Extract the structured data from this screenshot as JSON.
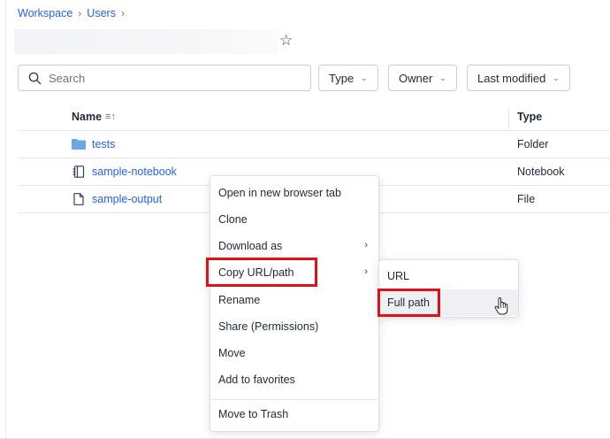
{
  "breadcrumb": {
    "items": [
      "Workspace",
      "Users"
    ],
    "separator": "›"
  },
  "header": {
    "star_glyph": "☆"
  },
  "toolbar": {
    "search_placeholder": "Search",
    "filters": [
      {
        "label": "Type",
        "chevron": "⌄"
      },
      {
        "label": "Owner",
        "chevron": "⌄"
      },
      {
        "label": "Last modified",
        "chevron": "⌄"
      }
    ]
  },
  "table": {
    "columns": {
      "name": "Name",
      "sort_glyph": "≡↑",
      "type": "Type"
    },
    "rows": [
      {
        "name": "tests",
        "type": "Folder",
        "icon": "folder-icon"
      },
      {
        "name": "sample-notebook",
        "type": "Notebook",
        "icon": "notebook-icon"
      },
      {
        "name": "sample-output",
        "type": "File",
        "icon": "file-icon"
      }
    ]
  },
  "context_menu": {
    "items": [
      {
        "label": "Open in new browser tab"
      },
      {
        "label": "Clone"
      },
      {
        "label": "Download as",
        "arrow": "›"
      },
      {
        "label": "Copy URL/path",
        "arrow": "›"
      },
      {
        "label": "Rename"
      },
      {
        "label": "Share (Permissions)"
      },
      {
        "label": "Move"
      },
      {
        "label": "Add to favorites"
      },
      {
        "label": "Move to Trash"
      }
    ]
  },
  "submenu": {
    "items": [
      {
        "label": "URL"
      },
      {
        "label": "Full path"
      }
    ]
  },
  "colors": {
    "link": "#2563eb",
    "highlight": "#e0101a",
    "folder": "#6aa6e8",
    "border": "#c9ced6"
  }
}
